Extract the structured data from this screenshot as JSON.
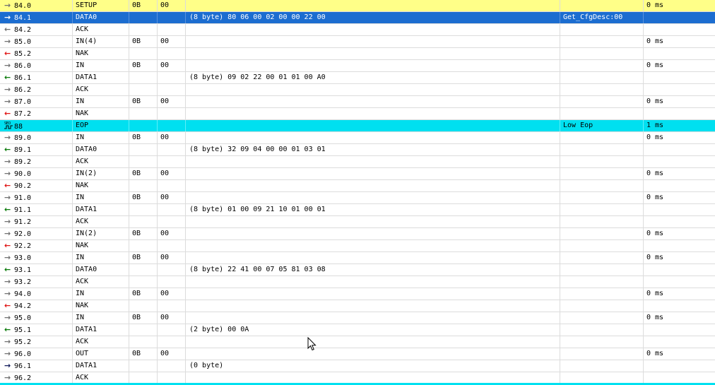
{
  "colors": {
    "setup_row": "#ffff88",
    "selected_row": "#1c6dd0",
    "eop_row": "#00e0f0"
  },
  "rows": [
    {
      "id": "84.0",
      "type": "SETUP",
      "addr": "0B",
      "ep": "00",
      "data": "",
      "desc": "",
      "time": "0 ms",
      "icon": "arrow-right-gray",
      "bg": "yellow"
    },
    {
      "id": "84.1",
      "type": "DATA0",
      "addr": "",
      "ep": "",
      "data": "(8 byte) 80 06 00 02 00 00 22 00",
      "desc": "Get_CfgDesc:00",
      "time": "",
      "icon": "arrow-right-gray",
      "bg": "blue"
    },
    {
      "id": "84.2",
      "type": "ACK",
      "addr": "",
      "ep": "",
      "data": "",
      "desc": "",
      "time": "",
      "icon": "arrow-left-gray",
      "bg": ""
    },
    {
      "id": "85.0",
      "type": "IN(4)",
      "addr": "0B",
      "ep": "00",
      "data": "",
      "desc": "",
      "time": "0 ms",
      "icon": "arrow-right-gray",
      "bg": ""
    },
    {
      "id": "85.2",
      "type": "NAK",
      "addr": "",
      "ep": "",
      "data": "",
      "desc": "",
      "time": "",
      "icon": "arrow-left-red",
      "bg": ""
    },
    {
      "id": "86.0",
      "type": "IN",
      "addr": "0B",
      "ep": "00",
      "data": "",
      "desc": "",
      "time": "0 ms",
      "icon": "arrow-right-gray",
      "bg": ""
    },
    {
      "id": "86.1",
      "type": "DATA1",
      "addr": "",
      "ep": "",
      "data": "(8 byte) 09 02 22 00 01 01 00 A0",
      "desc": "",
      "time": "",
      "icon": "arrow-left-green",
      "bg": ""
    },
    {
      "id": "86.2",
      "type": "ACK",
      "addr": "",
      "ep": "",
      "data": "",
      "desc": "",
      "time": "",
      "icon": "arrow-right-gray",
      "bg": ""
    },
    {
      "id": "87.0",
      "type": "IN",
      "addr": "0B",
      "ep": "00",
      "data": "",
      "desc": "",
      "time": "0 ms",
      "icon": "arrow-right-gray",
      "bg": ""
    },
    {
      "id": "87.2",
      "type": "NAK",
      "addr": "",
      "ep": "",
      "data": "",
      "desc": "",
      "time": "",
      "icon": "arrow-left-red",
      "bg": ""
    },
    {
      "id": "88",
      "type": "EOP",
      "addr": "",
      "ep": "",
      "data": "",
      "desc": "Low Eop",
      "time": "1 ms",
      "icon": "sof-icon",
      "bg": "cyan"
    },
    {
      "id": "89.0",
      "type": "IN",
      "addr": "0B",
      "ep": "00",
      "data": "",
      "desc": "",
      "time": "0 ms",
      "icon": "arrow-right-gray",
      "bg": ""
    },
    {
      "id": "89.1",
      "type": "DATA0",
      "addr": "",
      "ep": "",
      "data": "(8 byte) 32 09 04 00 00 01 03 01",
      "desc": "",
      "time": "",
      "icon": "arrow-left-green",
      "bg": ""
    },
    {
      "id": "89.2",
      "type": "ACK",
      "addr": "",
      "ep": "",
      "data": "",
      "desc": "",
      "time": "",
      "icon": "arrow-right-gray",
      "bg": ""
    },
    {
      "id": "90.0",
      "type": "IN(2)",
      "addr": "0B",
      "ep": "00",
      "data": "",
      "desc": "",
      "time": "0 ms",
      "icon": "arrow-right-gray",
      "bg": ""
    },
    {
      "id": "90.2",
      "type": "NAK",
      "addr": "",
      "ep": "",
      "data": "",
      "desc": "",
      "time": "",
      "icon": "arrow-left-red",
      "bg": ""
    },
    {
      "id": "91.0",
      "type": "IN",
      "addr": "0B",
      "ep": "00",
      "data": "",
      "desc": "",
      "time": "0 ms",
      "icon": "arrow-right-gray",
      "bg": ""
    },
    {
      "id": "91.1",
      "type": "DATA1",
      "addr": "",
      "ep": "",
      "data": "(8 byte) 01 00 09 21 10 01 00 01",
      "desc": "",
      "time": "",
      "icon": "arrow-left-green",
      "bg": ""
    },
    {
      "id": "91.2",
      "type": "ACK",
      "addr": "",
      "ep": "",
      "data": "",
      "desc": "",
      "time": "",
      "icon": "arrow-right-gray",
      "bg": ""
    },
    {
      "id": "92.0",
      "type": "IN(2)",
      "addr": "0B",
      "ep": "00",
      "data": "",
      "desc": "",
      "time": "0 ms",
      "icon": "arrow-right-gray",
      "bg": ""
    },
    {
      "id": "92.2",
      "type": "NAK",
      "addr": "",
      "ep": "",
      "data": "",
      "desc": "",
      "time": "",
      "icon": "arrow-left-red",
      "bg": ""
    },
    {
      "id": "93.0",
      "type": "IN",
      "addr": "0B",
      "ep": "00",
      "data": "",
      "desc": "",
      "time": "0 ms",
      "icon": "arrow-right-gray",
      "bg": ""
    },
    {
      "id": "93.1",
      "type": "DATA0",
      "addr": "",
      "ep": "",
      "data": "(8 byte) 22 41 00 07 05 81 03 08",
      "desc": "",
      "time": "",
      "icon": "arrow-left-green",
      "bg": ""
    },
    {
      "id": "93.2",
      "type": "ACK",
      "addr": "",
      "ep": "",
      "data": "",
      "desc": "",
      "time": "",
      "icon": "arrow-right-gray",
      "bg": ""
    },
    {
      "id": "94.0",
      "type": "IN",
      "addr": "0B",
      "ep": "00",
      "data": "",
      "desc": "",
      "time": "0 ms",
      "icon": "arrow-right-gray",
      "bg": ""
    },
    {
      "id": "94.2",
      "type": "NAK",
      "addr": "",
      "ep": "",
      "data": "",
      "desc": "",
      "time": "",
      "icon": "arrow-left-red",
      "bg": ""
    },
    {
      "id": "95.0",
      "type": "IN",
      "addr": "0B",
      "ep": "00",
      "data": "",
      "desc": "",
      "time": "0 ms",
      "icon": "arrow-right-gray",
      "bg": ""
    },
    {
      "id": "95.1",
      "type": "DATA1",
      "addr": "",
      "ep": "",
      "data": "(2 byte) 00 0A",
      "desc": "",
      "time": "",
      "icon": "arrow-left-green",
      "bg": ""
    },
    {
      "id": "95.2",
      "type": "ACK",
      "addr": "",
      "ep": "",
      "data": "",
      "desc": "",
      "time": "",
      "icon": "arrow-right-gray",
      "bg": ""
    },
    {
      "id": "96.0",
      "type": "OUT",
      "addr": "0B",
      "ep": "00",
      "data": "",
      "desc": "",
      "time": "0 ms",
      "icon": "arrow-right-gray",
      "bg": ""
    },
    {
      "id": "96.1",
      "type": "DATA1",
      "addr": "",
      "ep": "",
      "data": "(0 byte)",
      "desc": "",
      "time": "",
      "icon": "arrow-right-navy",
      "bg": ""
    },
    {
      "id": "96.2",
      "type": "ACK",
      "addr": "",
      "ep": "",
      "data": "",
      "desc": "",
      "time": "",
      "icon": "arrow-right-gray",
      "bg": ""
    }
  ]
}
